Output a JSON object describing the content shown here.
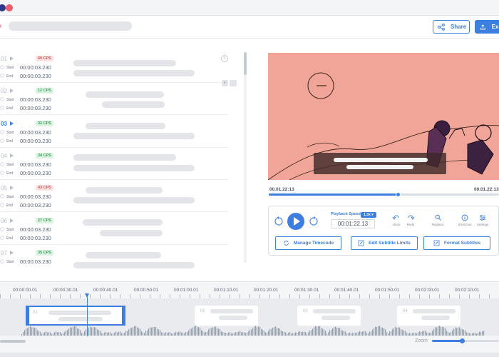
{
  "header": {
    "share_label": "Share",
    "export_label": "Export"
  },
  "subtitles": [
    {
      "number": "01",
      "cps": "60 CPS",
      "cps_status": "red",
      "start_label": "Start",
      "start": "00:00:03.230",
      "end_label": "End",
      "end": "00:00:03.230"
    },
    {
      "number": "02",
      "cps": "12 CPS",
      "cps_status": "green",
      "start_label": "Start",
      "start": "00:00:03.230",
      "end_label": "End",
      "end": "00:00:03.230"
    },
    {
      "number": "03",
      "cps": "32 CPS",
      "cps_status": "green",
      "start_label": "Start",
      "start": "00:00:03.230",
      "end_label": "End",
      "end": "00:00:03.230"
    },
    {
      "number": "04",
      "cps": "34 CPS",
      "cps_status": "green",
      "start_label": "Start",
      "start": "00:00:03.230",
      "end_label": "End",
      "end": "00:00:03.230"
    },
    {
      "number": "05",
      "cps": "43 CPS",
      "cps_status": "red",
      "start_label": "Start",
      "start": "00:00:03.230",
      "end_label": "End",
      "end": "00:00:03.230"
    },
    {
      "number": "06",
      "cps": "27 CPS",
      "cps_status": "green",
      "start_label": "Start",
      "start": "00:00:03.230",
      "end_label": "End",
      "end": "00:00:03.230"
    },
    {
      "number": "07",
      "cps": "35 CPS",
      "cps_status": "green",
      "start_label": "Start",
      "start": "00:00:03.230",
      "end_label": "End",
      "end": "00:00:03.230"
    }
  ],
  "player": {
    "current_time": "00.01.22:13",
    "total_time": "00.01.22:13",
    "progress": 0.56,
    "playback_speed_label": "Playback Speed",
    "playback_speed_value": "1.0x",
    "timecode": "00:01:22.13",
    "tools": {
      "undo": "Undo",
      "redo": "Redo",
      "replace": "Replace",
      "shortcuts": "Shortcuts",
      "settings": "Settings"
    },
    "buttons": {
      "manage_timecode": "Manage Timecode",
      "edit_limits": "Edit Subtitle Limits",
      "format_subtitles": "Format Subtitles"
    }
  },
  "timeline": {
    "ticks": [
      "00:00:00.01",
      "00:00:30.01",
      "00:00:40.01",
      "00:00:50.01",
      "00:01:00.01",
      "00:01:10.01",
      "00:01:20.01",
      "00:01:30.01",
      "00:01:40.01",
      "00:01:50.01",
      "00:02:00.01",
      "00:02:10.01"
    ],
    "clips": [
      "01",
      "02",
      "03",
      "04"
    ],
    "zoom_label": "Zoom",
    "zoom_level": 0.45
  },
  "colors": {
    "accent": "#3d7fe0",
    "video_bg": "#f0a598",
    "cps_red": "#e05252",
    "cps_green": "#3aa85a"
  }
}
